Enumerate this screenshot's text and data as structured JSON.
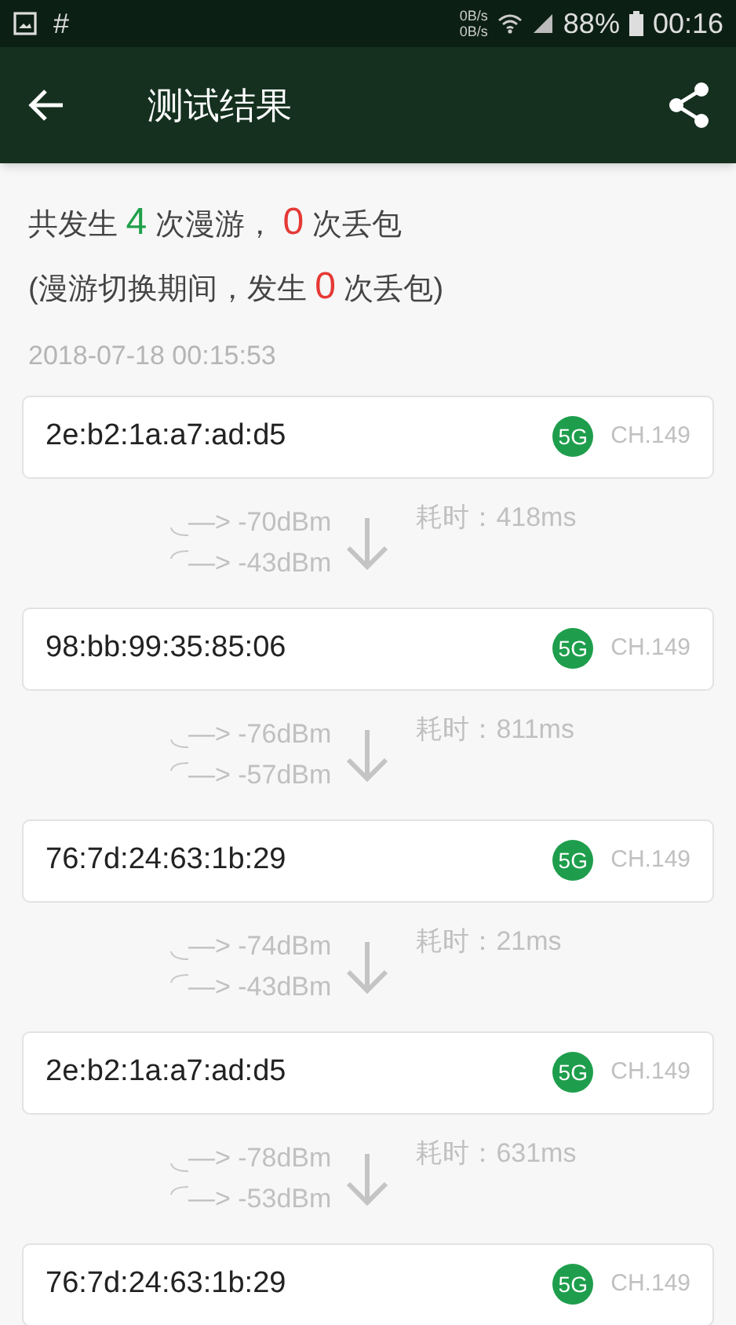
{
  "status_bar": {
    "hash": "#",
    "net_up": "0B/s",
    "net_down": "0B/s",
    "battery": "88%",
    "time": "00:16"
  },
  "app_bar": {
    "title": "测试结果"
  },
  "summary": [
    [
      {
        "text": "共发生 ",
        "kind": "plain"
      },
      {
        "text": "4",
        "kind": "good"
      },
      {
        "text": " 次漫游， ",
        "kind": "plain"
      },
      {
        "text": "0",
        "kind": "bad"
      },
      {
        "text": " 次丢包",
        "kind": "plain"
      }
    ],
    [
      {
        "text": "(漫游切换期间，发生 ",
        "kind": "plain"
      },
      {
        "text": "0",
        "kind": "bad"
      },
      {
        "text": " 次丢包)",
        "kind": "plain"
      }
    ]
  ],
  "timestamp": "2018-07-18 00:15:53",
  "entries": [
    {
      "kind": "ap",
      "mac": "2e:b2:1a:a7:ad:d5",
      "band": "5G",
      "channel": "CH.149"
    },
    {
      "kind": "switch",
      "from": "—> -70dBm",
      "to": "—> -43dBm",
      "duration": "耗时：418ms"
    },
    {
      "kind": "ap",
      "mac": "98:bb:99:35:85:06",
      "band": "5G",
      "channel": "CH.149"
    },
    {
      "kind": "switch",
      "from": "—> -76dBm",
      "to": "—> -57dBm",
      "duration": "耗时：811ms"
    },
    {
      "kind": "ap",
      "mac": "76:7d:24:63:1b:29",
      "band": "5G",
      "channel": "CH.149"
    },
    {
      "kind": "switch",
      "from": "—> -74dBm",
      "to": "—> -43dBm",
      "duration": "耗时：21ms"
    },
    {
      "kind": "ap",
      "mac": "2e:b2:1a:a7:ad:d5",
      "band": "5G",
      "channel": "CH.149"
    },
    {
      "kind": "switch",
      "from": "—> -78dBm",
      "to": "—> -53dBm",
      "duration": "耗时：631ms"
    },
    {
      "kind": "ap",
      "mac": "76:7d:24:63:1b:29",
      "band": "5G",
      "channel": "CH.149"
    }
  ]
}
